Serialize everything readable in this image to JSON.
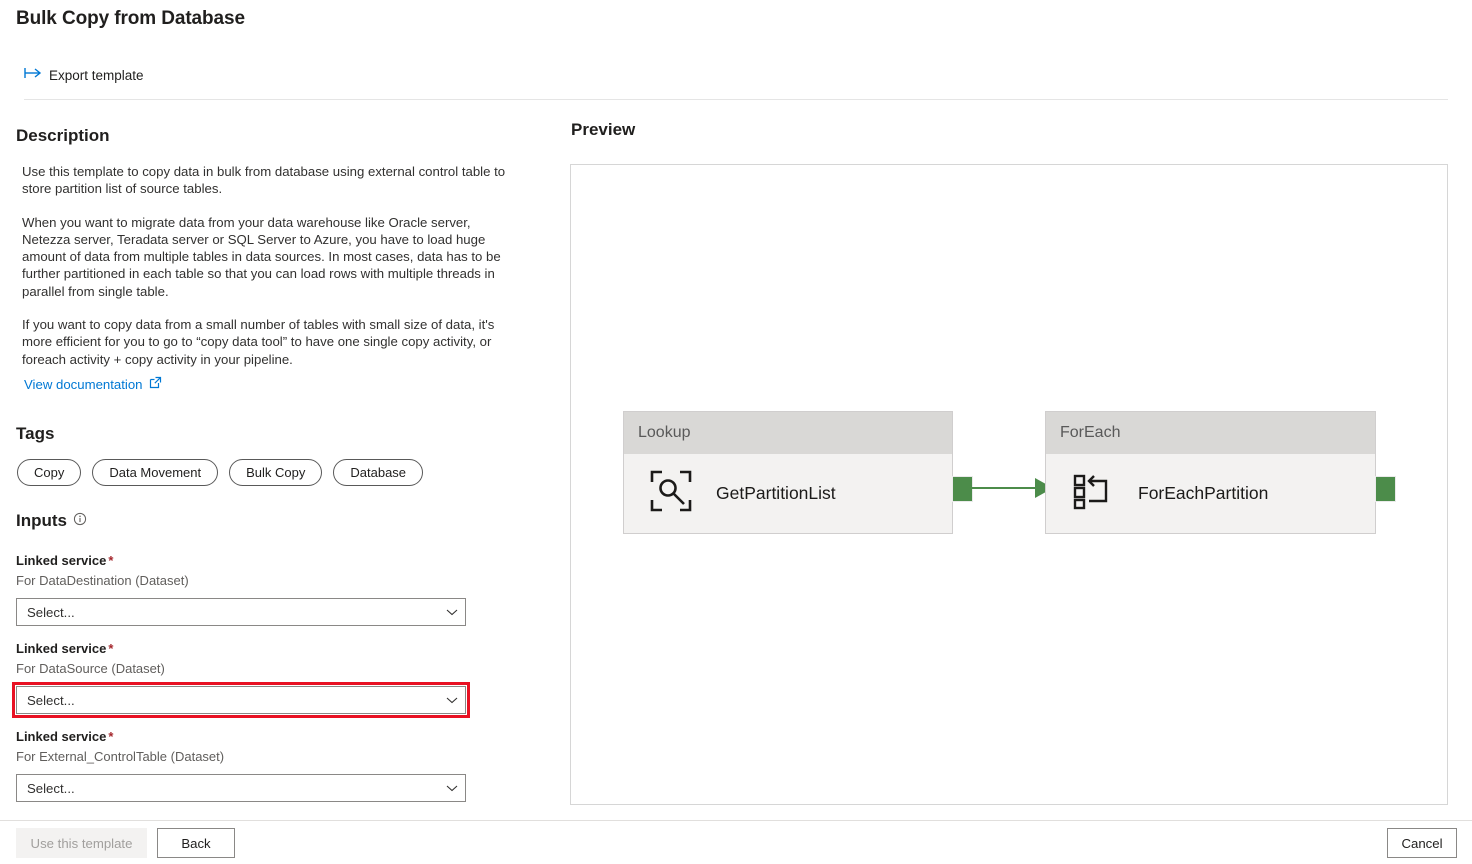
{
  "header": {
    "title": "Bulk Copy from Database",
    "export_label": "Export template",
    "export_icon": "export-arrow-icon"
  },
  "description": {
    "heading": "Description",
    "paragraphs": [
      "Use this template to copy data in bulk from database using external control table to store partition list of source tables.",
      "When you want to migrate data from your data warehouse like Oracle server, Netezza server, Teradata server or SQL Server to Azure, you have to load huge amount of data from multiple tables in data sources. In most cases, data has to be further partitioned in each table so that you can load rows with multiple threads in parallel from single table.",
      "If you want to copy data from a small number of tables with small size of data, it's more efficient for you to go to “copy data tool” to have one single copy activity, or foreach activity + copy activity in your pipeline."
    ],
    "doc_link_label": "View documentation",
    "doc_link_icon": "external-link-icon"
  },
  "tags": {
    "heading": "Tags",
    "items": [
      "Copy",
      "Data Movement",
      "Bulk Copy",
      "Database"
    ]
  },
  "inputs": {
    "heading": "Inputs",
    "info_icon": "info-circle-icon",
    "required_marker": "*",
    "chevron_icon": "chevron-down-icon",
    "fields": [
      {
        "label": "Linked service",
        "sublabel": "For DataDestination (Dataset)",
        "value": "Select...",
        "placeholder": "Select...",
        "highlighted": false
      },
      {
        "label": "Linked service",
        "sublabel": "For DataSource (Dataset)",
        "value": "Select...",
        "placeholder": "Select...",
        "highlighted": true
      },
      {
        "label": "Linked service",
        "sublabel": "For External_ControlTable (Dataset)",
        "value": "Select...",
        "placeholder": "Select...",
        "highlighted": false
      }
    ]
  },
  "preview": {
    "heading": "Preview",
    "nodes": [
      {
        "type": "Lookup",
        "name": "GetPartitionList",
        "icon": "lookup-magnifier-icon"
      },
      {
        "type": "ForEach",
        "name": "ForEachPartition",
        "icon": "foreach-loop-icon"
      }
    ]
  },
  "footer": {
    "use_template_label": "Use this template",
    "back_label": "Back",
    "cancel_label": "Cancel"
  },
  "colors": {
    "accent_blue": "#0078d4",
    "required_red": "#a4262c",
    "highlight_red": "#e81123",
    "pipeline_green": "#4c8c4a",
    "node_header_gray": "#d9d8d6",
    "node_body_gray": "#f3f2f1"
  }
}
